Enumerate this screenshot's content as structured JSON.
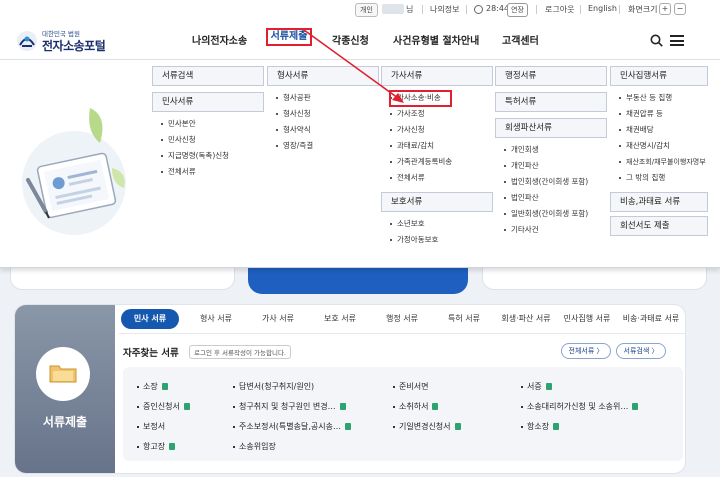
{
  "util": {
    "badge": "개인",
    "suffix": "님",
    "my_info": "나의정보",
    "time": "28:44",
    "extend": "연장",
    "logout": "로그아웃",
    "english": "English",
    "font_size": "화면크기",
    "plus": "+",
    "minus": "−"
  },
  "header": {
    "logo_small": "대한민국 법원",
    "logo_big": "전자소송포털",
    "nav": [
      "나의전자소송",
      "서류제출",
      "각종신청",
      "사건유형별 절차안내",
      "고객센터"
    ],
    "active_index": 1
  },
  "mega": {
    "col1": {
      "heads": [
        "서류검색",
        "민사서류"
      ],
      "items": [
        "민사본안",
        "민사신청",
        "지급명령(독촉)신청",
        "전체서류"
      ]
    },
    "col2": {
      "head": "형사서류",
      "items": [
        "형사공판",
        "형사신청",
        "형사약식",
        "영장/즉결"
      ]
    },
    "col3": {
      "head": "가사서류",
      "items": [
        "가사소송·비송",
        "가사조정",
        "가사신청",
        "과태료/감치",
        "가족관계등록비송",
        "전체서류"
      ],
      "head2": "보호서류",
      "items2": [
        "소년보호",
        "가정아동보호"
      ]
    },
    "col4": {
      "head": "행정서류",
      "head2": "특허서류",
      "head3": "회생파산서류",
      "items3": [
        "개인회생",
        "개인파산",
        "법인회생(간이회생 포함)",
        "법인파산",
        "일반회생(간이회생 포함)",
        "기타사건"
      ]
    },
    "col5": {
      "head": "민사집행서류",
      "items": [
        "부동산 등 집행",
        "채권압류 등",
        "채권배당",
        "재산명시/감치",
        "재산조회/채무불이행자명부",
        "그 밖의 집행"
      ],
      "head2": "비송,과태료 서류",
      "head3": "회선서도 제출"
    }
  },
  "doc": {
    "left_label": "서류제출",
    "tabs": [
      "민사 서류",
      "형사 서류",
      "가사 서류",
      "보호 서류",
      "행정 서류",
      "특허 서류",
      "회생·파산 서류",
      "민사집행 서류",
      "비송·과태료 서류"
    ],
    "freq_title": "자주찾는 서류",
    "freq_hint": "로그인 후 서류작성이 가능합니다.",
    "all_docs_btn": "전체서류 〉",
    "doc_search_btn": "서류검색 〉",
    "items": [
      [
        "소장",
        "답변서(청구취지/원인)",
        "준비서면",
        "서증"
      ],
      [
        "증인신청서",
        "청구취지 및 청구원인 변경…",
        "소취하서",
        "소송대리허가신청 및 소송위…"
      ],
      [
        "보정서",
        "주소보정서(특별송달,공시송…",
        "기일변경신청서",
        "항소장"
      ],
      [
        "항고장",
        "소송위임장",
        "",
        ""
      ]
    ],
    "items_with_icon": [
      [
        true,
        false,
        false,
        true
      ],
      [
        true,
        true,
        true,
        true
      ],
      [
        false,
        true,
        true,
        true
      ],
      [
        true,
        false,
        false,
        false
      ]
    ]
  },
  "colors": {
    "accent": "#1558b0",
    "highlight": "#e0202e",
    "brand_navy": "#1b2f6b"
  }
}
